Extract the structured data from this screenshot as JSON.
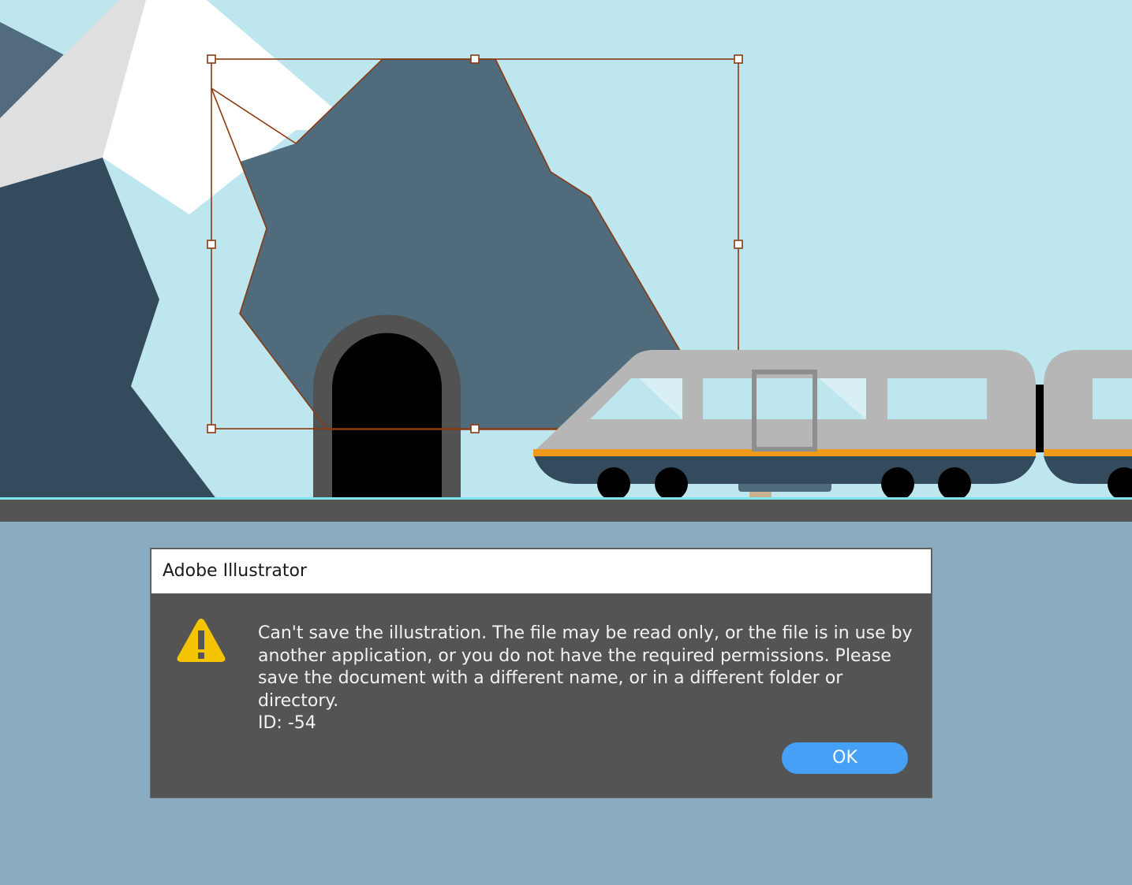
{
  "app": {
    "name": "Adobe Illustrator"
  },
  "dialog": {
    "title": "Adobe Illustrator",
    "message": "Can't save the illustration. The file may be read only, or the file is in use by\nanother application, or you do not have the required permissions. Please\nsave the document with a different name, or in a different folder or directory.\nID: -54",
    "ok_label": "OK",
    "icon": "warning-icon"
  },
  "colors": {
    "sky": "#bde6ee",
    "ground": "#545454",
    "backdrop": "#8aacc0",
    "dialog_bg": "#545454",
    "button_accent": "#46a0f5",
    "warning": "#f5c400",
    "selection": "#8a3a10",
    "train_body": "#b6b6b6",
    "train_stripe": "#f09a1a",
    "train_base": "#344b5e"
  }
}
